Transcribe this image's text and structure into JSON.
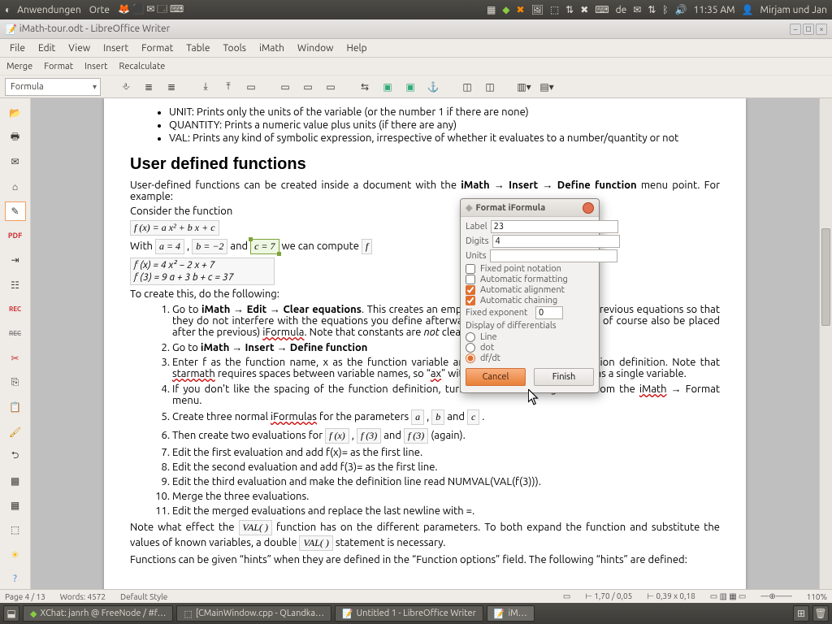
{
  "panel": {
    "menu1": "Anwendungen",
    "menu2": "Orte",
    "lang": "de",
    "clock": "11:35 AM",
    "user": "Mirjam und Jan"
  },
  "window": {
    "title": "iMath-tour.odt - LibreOffice Writer"
  },
  "menubar": [
    "File",
    "Edit",
    "View",
    "Insert",
    "Format",
    "Table",
    "Tools",
    "iMath",
    "Window",
    "Help"
  ],
  "subbar": [
    "Merge",
    "Format",
    "Insert",
    "Recalculate"
  ],
  "combo": "Formula",
  "doc": {
    "bullets": [
      "UNIT: Prints only the units of the variable (or the number 1 if there are none)",
      "QUANTITY: Prints a numeric value plus units (if there are any)",
      "VAL: Prints any kind of symbolic expression, irrespective of whether it evaluates to a number/quantity or not"
    ],
    "h2": "User defined functions",
    "intro1a": "User-defined functions can be created inside a document with the ",
    "intro1b": "iMath → Insert → Define function",
    "intro1c": " menu point. For example:",
    "consider": "Consider the function",
    "eq1": "f (x) = a x² + b x + c",
    "witha": "With ",
    "eq_a": "a = 4",
    "comma": " , ",
    "eq_b": "b = −2",
    "and": " and ",
    "eq_c": "c = 7",
    "compute": " we can compute ",
    "eq_fx_partial": "f",
    "eqtable1": "f (x)   =   4 x² − 2 x + 7",
    "eqtable2": "f (3)   =   9 a + 3 b + c   =   37",
    "tocreate": "To create this, do the following:",
    "steps": [
      "Go to iMath → Edit → Clear equations. This creates an empty iFormula which clears all previous equations so that they do not interfere with the equations you define afterwards. The empty iFormula can of course also be placed after the previous) iFormula. Note that constants are not cleared.",
      "Go to iMath → Insert → Define function",
      "Enter f as the function name, x as the function variable and a*x^2+b*x+c as the function definition. Note that starmath requires spaces between variable names, so “ax” without a space will be treated as a single variable.",
      "If you don't like the spacing of the function definition, turn off automatic alignment from the iMath → Format menu.",
      "Create three normal iFormulas for the parameters  a ,  b  and  c .",
      "Then create two evaluations for  f (x) ,  f (3)  and  f (3)  (again).",
      "Edit the first evaluation and add  f(x)= as the first line.",
      "Edit the second evaluation and add f(3)= as the first line.",
      "Edit the third evaluation and make the definition line read NUMVAL(VAL(f(3))).",
      "Merge the three evaluations.",
      "Edit the merged evaluations and replace the last newline with =."
    ],
    "note1a": "Note what effect the ",
    "note1b": "VAL( )",
    "note1c": " function  has on the different parameters. To both expand the function and substitute the values of known variables, a double ",
    "note1d": "VAL( )",
    "note1e": " statement is necessary.",
    "note2": "Functions can be given “hints” when they are defined in the “Function options” field. The following “hints” are defined:"
  },
  "dialog": {
    "title": "Format iFormula",
    "label_lbl": "Label",
    "label_val": "23",
    "digits_lbl": "Digits",
    "digits_val": "4",
    "units_lbl": "Units",
    "units_val": "",
    "chk_fixed": "Fixed point notation",
    "chk_autofmt": "Automatic formatting",
    "chk_autoalign": "Automatic alignment",
    "chk_autochain": "Automatic chaining",
    "fixedexp_lbl": "Fixed exponent",
    "fixedexp_val": "0",
    "diff_lbl": "Display of differentials",
    "rad_line": "Line",
    "rad_dot": "dot",
    "rad_dfdt": "df/dt",
    "cancel": "Cancel",
    "finish": "Finish"
  },
  "status": {
    "page": "Page 4 / 13",
    "words": "Words: 4572",
    "style": "Default Style",
    "caret": "1,70 / 0,05",
    "sel": "0,39 x 0,18",
    "zoom": "110%"
  },
  "taskbar": {
    "t1": "XChat: janrh @ FreeNode / #f…",
    "t2": "[CMainWindow.cpp - QLandka…",
    "t3": "Untitled 1 - LibreOffice Writer",
    "t4": "iM…"
  }
}
